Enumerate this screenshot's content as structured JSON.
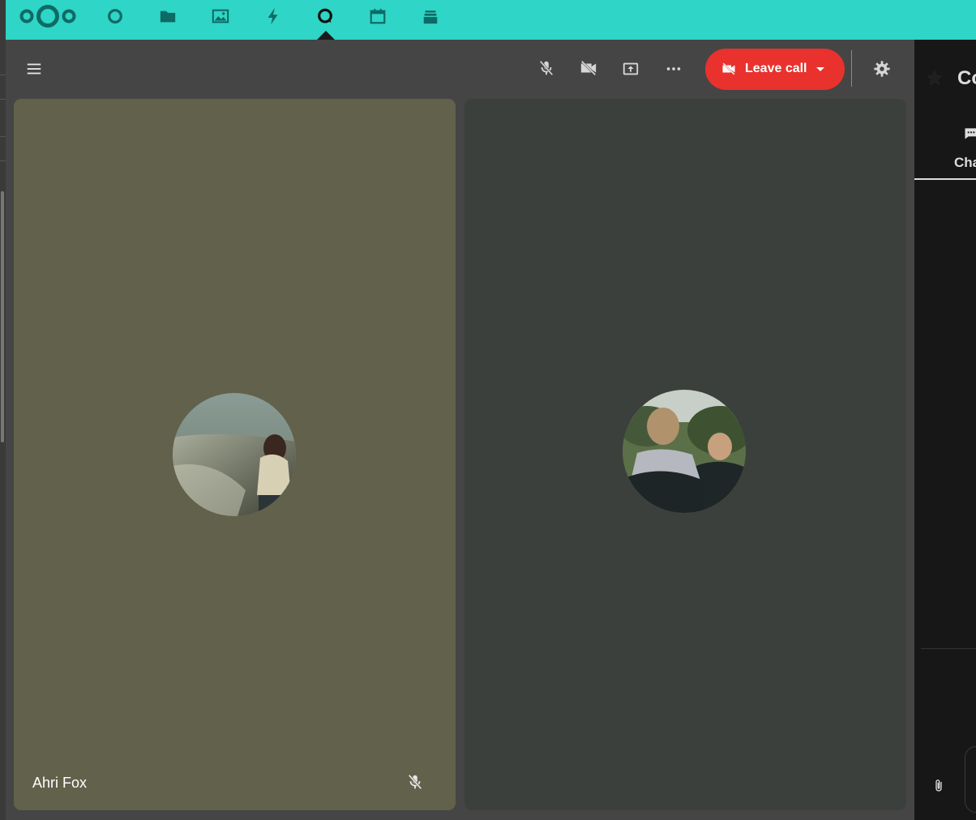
{
  "header": {
    "brand": "Nextcloud",
    "apps": [
      {
        "name": "dashboard",
        "icon": "circle-icon"
      },
      {
        "name": "files",
        "icon": "folder-icon"
      },
      {
        "name": "photos",
        "icon": "image-icon"
      },
      {
        "name": "activity",
        "icon": "bolt-icon"
      },
      {
        "name": "talk",
        "icon": "talk-icon",
        "active": true
      },
      {
        "name": "calendar",
        "icon": "calendar-icon"
      },
      {
        "name": "deck",
        "icon": "stack-icon"
      }
    ],
    "color": "#2fd5c6"
  },
  "call_toolbar": {
    "menu_icon": "hamburger-icon",
    "mic_icon": "microphone-off-icon",
    "video_icon": "video-off-icon",
    "screen_share_icon": "screen-share-icon",
    "more_icon": "more-horizontal-icon",
    "leave_call_label": "Leave call",
    "settings_icon": "gear-icon",
    "leave_color": "#e9322d"
  },
  "participants": [
    {
      "name": "Ahri Fox",
      "muted": true,
      "tile_color": "#62614b"
    },
    {
      "name": "",
      "muted": false,
      "tile_color": "#3c403c"
    }
  ],
  "sidebar": {
    "title": "Co",
    "tab_label": "Cha",
    "tab_icon": "message-icon",
    "attach_icon": "paperclip-icon"
  }
}
